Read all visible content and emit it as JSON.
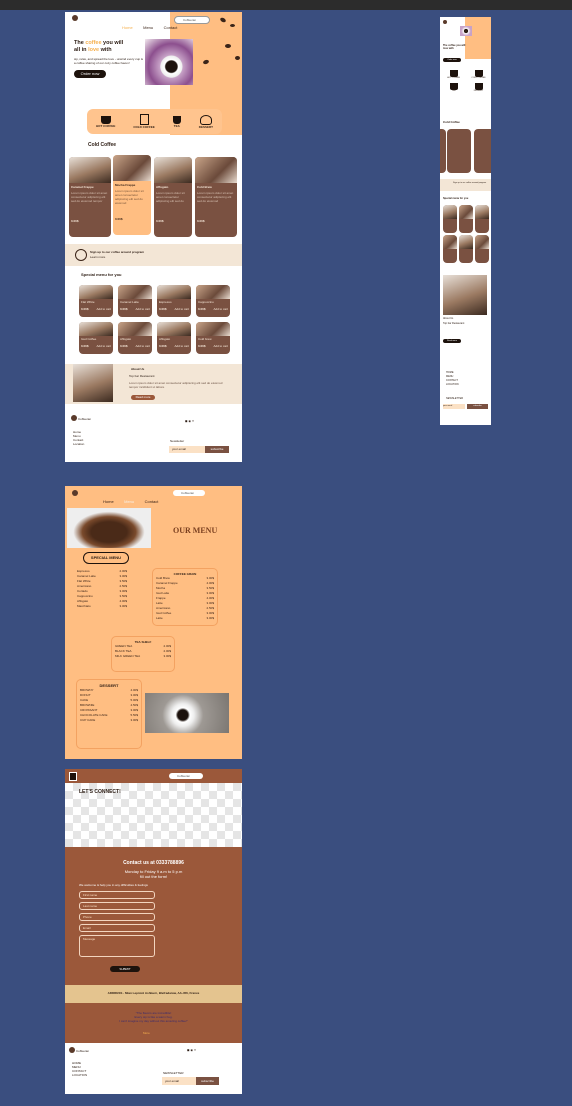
{
  "colors": {
    "canvas": "#3a4e7f",
    "peach": "#ffbe82",
    "brown": "#9b583a",
    "dark": "#1d120c",
    "cream": "#f3e6d6"
  },
  "home": {
    "nav": {
      "links": [
        "Home",
        "Menu",
        "Contact"
      ],
      "search_placeholder": "Coffeeran"
    },
    "hero": {
      "title_pre": "The ",
      "title_coffee": "coffee",
      "title_mid": " you will",
      "title_line2_pre": "all in ",
      "title_love": "love",
      "title_post": " with",
      "subtitle": "sip, relax, and spread the love - unwind every cup is a coffee sharing of our cozy coffee haven!",
      "cta": "Order now"
    },
    "categories": [
      {
        "icon": "hot-coffee-icon",
        "label": "HOT COFFEE"
      },
      {
        "icon": "cold-coffee-icon",
        "label": "COLD COFFEE"
      },
      {
        "icon": "tea-icon",
        "label": "TEA"
      },
      {
        "icon": "dessert-icon",
        "label": "DESSERT"
      }
    ],
    "cold_title": "Cold Coffee",
    "cold_cards": [
      {
        "name": "Caramel Frappe",
        "price": "0.00$",
        "btn": "Add to cart"
      },
      {
        "name": "Mocha Frappe",
        "price": "0.00$",
        "btn": "Add to cart"
      },
      {
        "name": "Affogato",
        "price": "0.00$",
        "btn": "Add to cart"
      },
      {
        "name": "Cold Brew",
        "price": "0.00$",
        "btn": "Add to cart"
      }
    ],
    "signup": {
      "text": "Sign up to our coffee around program",
      "link": "Learn more"
    },
    "special_title": "Special menu for you",
    "special_items": [
      "Flat White",
      "Caramel Latte",
      "Espresso",
      "Cappuccino",
      "Iced Coffee",
      "Affogato",
      "Affogato",
      "Cold brew"
    ],
    "special_price": "0.00$",
    "special_btn": "Add to cart",
    "about": {
      "title": "About Us",
      "subtitle": "Top bar Restaurant",
      "button": "Read more"
    },
    "footer": {
      "brand": "Coffeeran",
      "links": [
        "Home",
        "Menu",
        "Contact",
        "Location"
      ],
      "newsletter": "Newsletter",
      "email_placeholder": "your email",
      "subscribe": "subscribe"
    }
  },
  "mobile": {
    "nav_label": "Coffeeran",
    "hero_title": "The coffee you will love with",
    "cta": "Order now",
    "categories": [
      "HOT COFFEE",
      "COLD COFFEE",
      "TEA",
      "DESSERT"
    ],
    "cold_title": "Cold Coffee",
    "signup": "Sign up to our coffee around program",
    "special_title": "Special menu for you",
    "about_title": "About Us",
    "about_subtitle": "Top bar Restaurant",
    "read_more": "Read more",
    "links": [
      "HOME",
      "MENU",
      "CONTACT",
      "LOCATION"
    ],
    "newsletter": "NEWSLETTER",
    "email": "your email",
    "subscribe": "subscribe"
  },
  "menu": {
    "nav": {
      "links": [
        "Home",
        "Menu",
        "Contact"
      ],
      "search_placeholder": "Coffeeran"
    },
    "title": "OUR MENU",
    "badge": "SPECIAL MENU",
    "special": [
      [
        "Espresso",
        "2.00$"
      ],
      [
        "Caramel Latte",
        "3.00$"
      ],
      [
        "Flat White",
        "3.50$"
      ],
      [
        "Americano",
        "2.50$"
      ],
      [
        "Cortado",
        "3.00$"
      ],
      [
        "Cappuccino",
        "3.50$"
      ],
      [
        "Affogato",
        "4.00$"
      ],
      [
        "Macchiato",
        "3.00$"
      ]
    ],
    "coffee_title": "COFFEE GRAIN",
    "coffee": [
      [
        "Cold Brew",
        "3.00$"
      ],
      [
        "Caramel Frappe",
        "4.00$"
      ],
      [
        "Mocha",
        "3.50$"
      ],
      [
        "Iced Latte",
        "3.00$"
      ],
      [
        "Frappe",
        "4.00$"
      ],
      [
        "Latte",
        "3.00$"
      ],
      [
        "Americano",
        "2.50$"
      ],
      [
        "Iced Coffee",
        "3.00$"
      ],
      [
        "Latte",
        "3.00$"
      ]
    ],
    "tea_title": "TEA SHELF",
    "tea": [
      [
        "GREEN TEA",
        "2.00$"
      ],
      [
        "BLACK TEA",
        "2.00$"
      ],
      [
        "MILK GREEN TEA",
        "3.00$"
      ]
    ],
    "dessert_title": "DESSERT",
    "dessert": [
      [
        "BROWNY",
        "4.00$"
      ],
      [
        "DONUT",
        "3.00$"
      ],
      [
        "CAKE",
        "5.00$"
      ],
      [
        "BROWNIE",
        "4.50$"
      ],
      [
        "CROISSANT",
        "3.00$"
      ],
      [
        "CHOCOLATE CAKE",
        "5.50$"
      ],
      [
        "CUP CAKE",
        "3.00$"
      ]
    ]
  },
  "contact": {
    "nav": {
      "links": [
        "Home",
        "Menu",
        "Contacts"
      ],
      "search_placeholder": "Coffeeran"
    },
    "lets_connect": "LET'S CONNECT!",
    "contact_line": "Contact us at 0333788896",
    "hours_line1": "Monday to Friday 9 a.m to 5 p.m",
    "hours_line2": "fill out the form!",
    "note": "We welcome & help you in any difficulties & feelings",
    "fields": [
      "First name",
      "Last name",
      "Phone",
      "Email",
      "Message"
    ],
    "submit": "SUBMIT",
    "address": "ADDRESS · Mian Lepistol Ashburn, Blefradaraw, AA-456, France",
    "quote1": "\"The flavors are incredible!",
    "quote2": "Every sip is like a warm hug.",
    "quote3": "I can't imagine my day without this amazing coffee!\"",
    "quote_more": "More",
    "footer": {
      "brand": "Coffeeran",
      "links": [
        "HOME",
        "MENU",
        "CONTACT",
        "LOCATION"
      ],
      "newsletter": "NEWSLETTER",
      "email": "your email",
      "subscribe": "subscribe"
    }
  }
}
